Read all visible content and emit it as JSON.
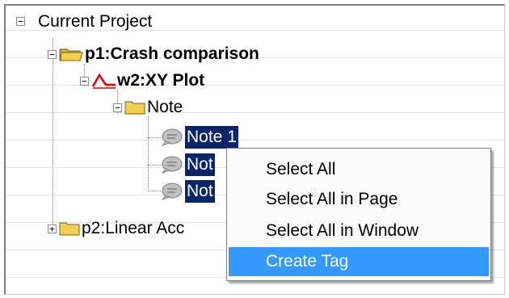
{
  "tree": {
    "root": "Current Project",
    "page1": "p1:Crash comparison",
    "window": "w2:XY Plot",
    "folder": "Note",
    "note1": "Note 1",
    "note2": "Not",
    "note3": "Not",
    "page2": "p2:Linear Acc"
  },
  "context_menu": {
    "items": [
      "Select All",
      "Select All in Page",
      "Select All in Window",
      "Create Tag"
    ],
    "highlighted": "Create Tag"
  },
  "colors": {
    "selection": "#0a246a",
    "menu_highlight": "#3399ff",
    "folder": "#f0d050",
    "xy_icon": "#e00000"
  }
}
